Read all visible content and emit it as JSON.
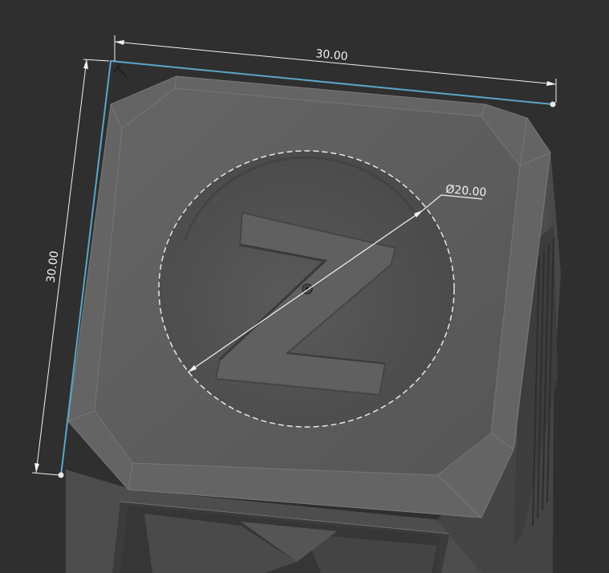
{
  "dimensions": {
    "top_width": "30.00",
    "left_height": "30.00",
    "diameter": "Ø20.00"
  },
  "colors": {
    "background": "#2f2f2f",
    "model_face": "#5a5a5a",
    "model_bevel": "#6a6a6a",
    "model_side": "#4a4a4a",
    "selection_edge": "#5aa6c8",
    "dimension_line": "#f2f2f2"
  },
  "icons": {
    "sketch_constraint": "perpendicular-constraint-icon",
    "center_point": "center-point-icon"
  }
}
